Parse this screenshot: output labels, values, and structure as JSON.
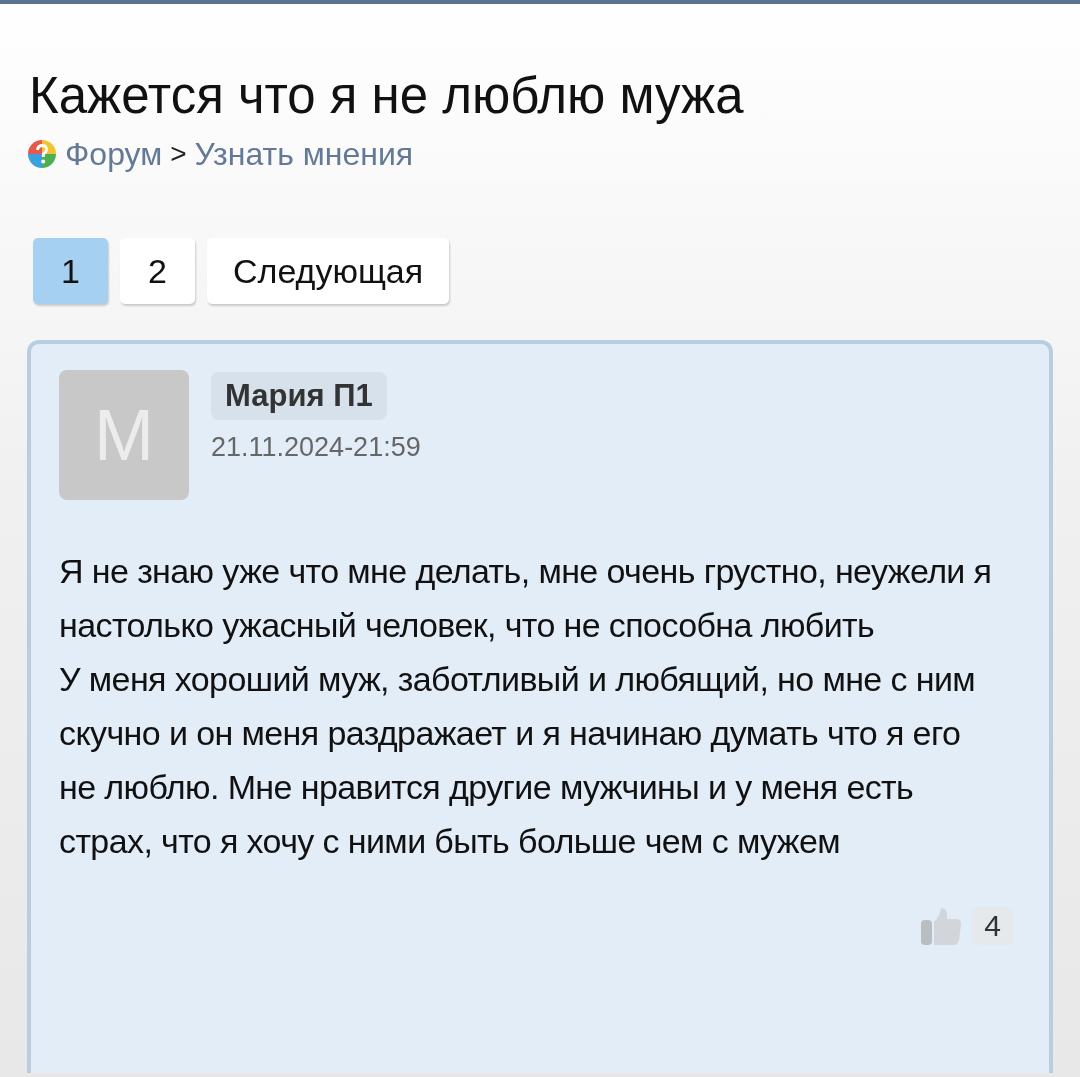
{
  "title": "Кажется что я не люблю мужа",
  "breadcrumb": {
    "items": [
      "Форум",
      "Узнать мнения"
    ],
    "separator": ">"
  },
  "pagination": [
    {
      "label": "1",
      "selected": true
    },
    {
      "label": "2",
      "selected": false
    },
    {
      "label": "Следующая",
      "selected": false
    }
  ],
  "post": {
    "avatar_letter": "M",
    "author": "Мария П1",
    "date": "21.11.2024-21:59",
    "paragraphs": [
      "Я не знаю уже что мне делать, мне очень грустно, неужели я настолько ужасный человек, что не способна любить",
      "У меня хороший муж, заботливый и любящий, но мне с ним скучно и он меня раздражает и я начинаю думать что я его не люблю. Мне нравится другие мужчины и у меня есть страх, что я хочу с ними быть больше чем с мужем"
    ],
    "likes": "4"
  }
}
